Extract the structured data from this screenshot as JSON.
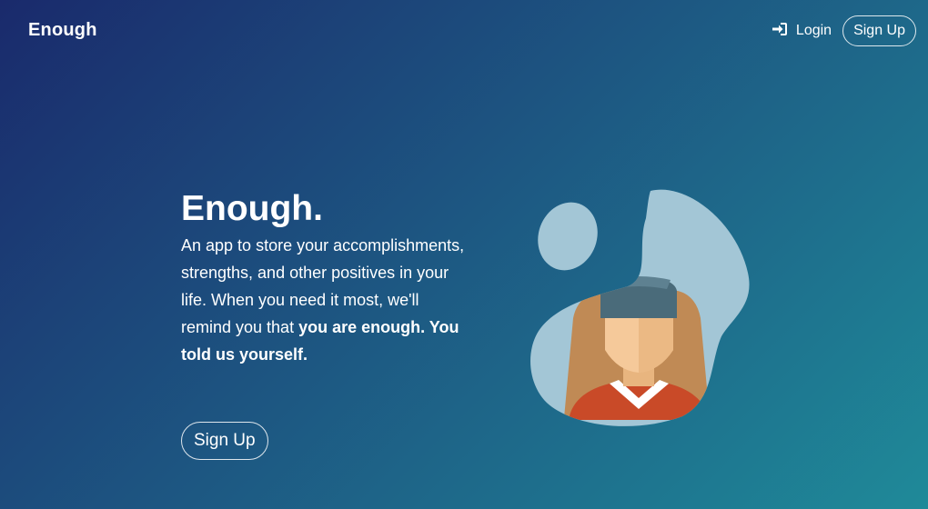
{
  "navbar": {
    "brand": "Enough",
    "login_label": "Login",
    "signup_label": "Sign Up",
    "login_icon": "sign-in-icon"
  },
  "hero": {
    "title": "Enough.",
    "description_plain": "An app to store your accomplishments, strengths, and other positives in your life. When you need it most, we'll remind you that",
    "description_bold": "you are enough. You told us yourself.",
    "signup_label": "Sign Up"
  },
  "colors": {
    "gradient_start": "#1a2a6c",
    "gradient_end": "#1f8a99",
    "blob": "#a3c6d6",
    "shirt": "#c94a28",
    "beanie": "#4a6b7a",
    "hair": "#c08a55",
    "skin": "#f5c99a"
  }
}
